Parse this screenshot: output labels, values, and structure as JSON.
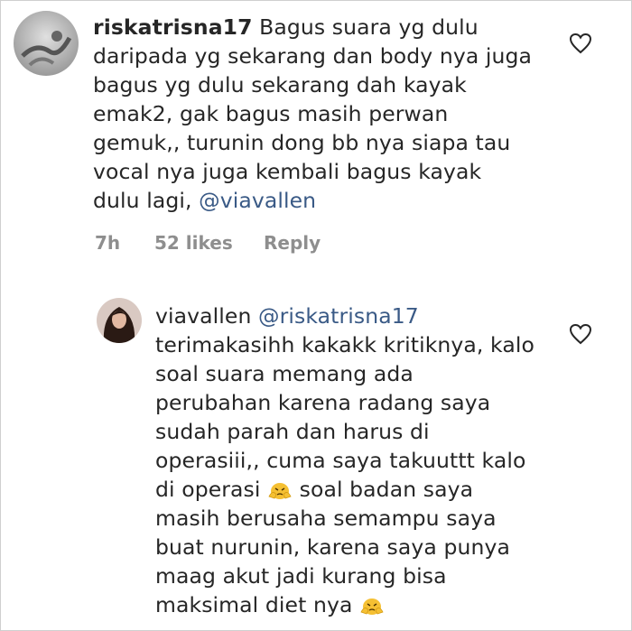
{
  "comment": {
    "username": "riskatrisna17",
    "lines": [
      "Bagus suara yg dulu",
      "daripada yg sekarang dan body nya juga",
      "bagus yg dulu sekarang dah kayak",
      "emak2, gak bagus masih perwan",
      "gemuk,, turunin dong bb nya siapa tau",
      "vocal nya juga kembali bagus kayak",
      "dulu lagi, "
    ],
    "mention": "@viavallen",
    "time": "7h",
    "likes": "52 likes",
    "reply_label": "Reply"
  },
  "reply": {
    "username": "viavallen",
    "mention": "@riskatrisna17",
    "lines": [
      "terimakasihh kakakk kritiknya, kalo",
      "soal suara memang ada",
      "perubahan karena radang saya",
      "sudah parah dan harus di",
      "operasiii,, cuma saya takuuttt kalo",
      "di operasi ",
      " soal badan  saya",
      "masih berusaha semampu saya",
      "buat nurunin, karena saya punya",
      "maag akut jadi kurang bisa",
      "maksimal diet nya "
    ]
  },
  "icons": {
    "heart": "heart-outline-icon",
    "emoji": "pleading-face-emoji"
  },
  "colors": {
    "text": "#262626",
    "mention": "#3a5a86",
    "meta": "#8e8e8e",
    "emoji": "#f5c033"
  }
}
